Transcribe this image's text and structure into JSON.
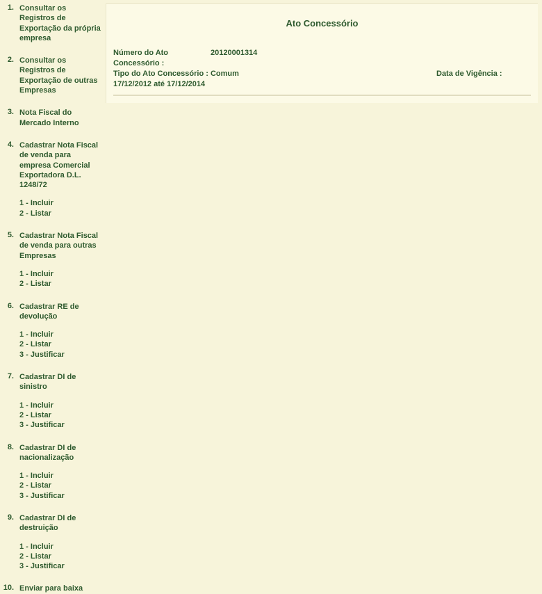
{
  "panel": {
    "title": "Ato Concessório",
    "numero_label": "Número do Ato Concessório :",
    "numero_value": "20120001314",
    "tipo_label": "Tipo do Ato Concessório : Comum",
    "vigencia_label": "Data de Vigência :",
    "vigencia_value": "17/12/2012 até 17/12/2014"
  },
  "menu": [
    {
      "num": "1.",
      "title": "Consultar os Registros de Exportação da própria empresa",
      "subs": []
    },
    {
      "num": "2.",
      "title": "Consultar os Registros de Exportação de outras Empresas",
      "subs": []
    },
    {
      "num": "3.",
      "title": "Nota Fiscal do Mercado Interno",
      "subs": []
    },
    {
      "num": "4.",
      "title": "Cadastrar Nota Fiscal de venda para empresa Comercial Exportadora D.L. 1248/72",
      "subs": [
        "1 - Incluir",
        "2 - Listar"
      ]
    },
    {
      "num": "5.",
      "title": "Cadastrar Nota Fiscal de venda para outras Empresas",
      "subs": [
        "1 - Incluir",
        "2 - Listar"
      ]
    },
    {
      "num": "6.",
      "title": "Cadastrar RE de devolução",
      "subs": [
        "1 - Incluir",
        "2 - Listar",
        "3 - Justificar"
      ]
    },
    {
      "num": "7.",
      "title": "Cadastrar DI de sinistro",
      "subs": [
        "1 - Incluir",
        "2 - Listar",
        "3 - Justificar"
      ]
    },
    {
      "num": "8.",
      "title": "Cadastrar DI de nacionalização",
      "subs": [
        "1 - Incluir",
        "2 - Listar",
        "3 - Justificar"
      ]
    },
    {
      "num": "9.",
      "title": "Cadastrar DI de destruição",
      "subs": [
        "1 - Incluir",
        "2 - Listar",
        "3 - Justificar"
      ]
    },
    {
      "num": "10.",
      "title": "Enviar para baixa",
      "subs": []
    }
  ]
}
